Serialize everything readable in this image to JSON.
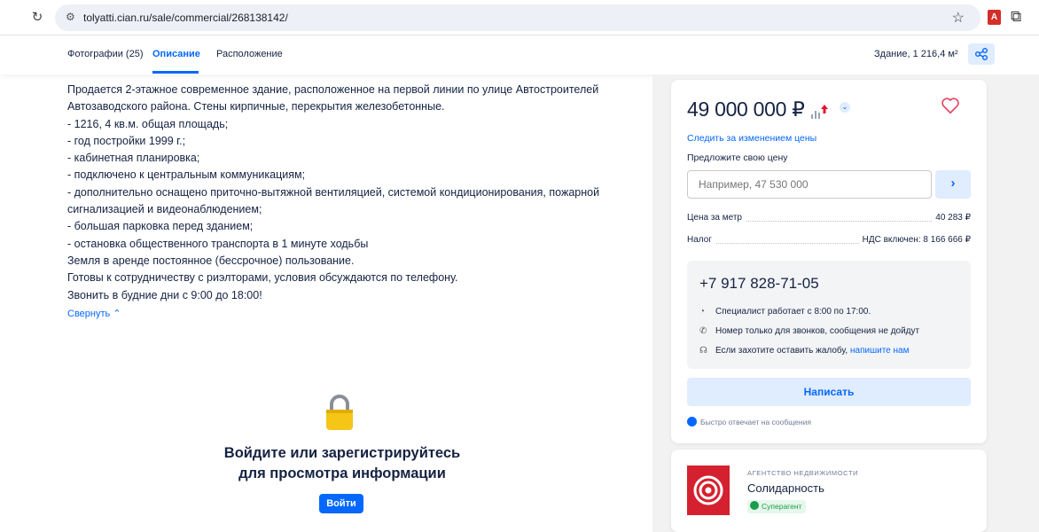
{
  "browser": {
    "url": "tolyatti.cian.ru/sale/commercial/268138142/",
    "pdf_ext_label": "A"
  },
  "tabs": [
    {
      "label": "Фотографии (25)"
    },
    {
      "label": "Описание"
    },
    {
      "label": "Расположение"
    }
  ],
  "header": {
    "building_info": "Здание, 1 216,4 м²"
  },
  "description": {
    "lines": [
      "Продается 2-этажное современное здание, расположенное на первой линии по улице Автостроителей",
      "Автозаводского района. Стены кирпичные, перекрытия железобетонные.",
      "- 1216, 4 кв.м. общая площадь;",
      "- год постройки 1999 г.;",
      "- кабинетная планировка;",
      "- подключено к центральным коммуникациям;",
      "- дополнительно оснащено приточно-вытяжной вентиляцией, системой кондиционирования, пожарной",
      "сигнализацией и видеонаблюдением;",
      "- большая парковка перед зданием;",
      "- остановка общественного транспорта в 1 минуте ходьбы",
      "Земля в аренде  постоянное (бессрочное) пользование.",
      "Готовы к сотрудничеству с риэлторами, условия обсуждаются по телефону.",
      "Звонить в будние дни с 9:00 до 18:00!"
    ],
    "collapse_label": "Свернуть ⌃"
  },
  "login": {
    "title_line1": "Войдите или зарегистрируйтесь",
    "title_line2": "для просмотра информации",
    "button_label": "Войти"
  },
  "price_card": {
    "price": "49 000 000 ₽",
    "follow_label": "Следить за изменением цены",
    "offer_label": "Предложите свою цену",
    "offer_placeholder": "Например, 47 530 000",
    "rows": [
      {
        "label": "Цена за метр",
        "value": "40 283 ₽"
      },
      {
        "label": "Налог",
        "value": "НДС включен: 8 166 666 ₽"
      }
    ],
    "phone": "+7 917 828-71-05",
    "info": {
      "hours": "Специалист работает с 8:00 по 17:00.",
      "calls_only": "Номер только для звонков, сообщения не дойдут",
      "complaint_text": "Если захотите оставить жалобу,",
      "complaint_link": "напишите нам"
    },
    "write_label": "Написать",
    "fast_reply": "Быстро отвечает на сообщения"
  },
  "agency": {
    "type": "АГЕНТСТВО НЕДВИЖИМОСТИ",
    "name": "Солидарность",
    "badge": "Суперагент"
  },
  "colors": {
    "accent": "#0468ff",
    "accent_light": "#e0ecff",
    "text": "#152242",
    "heart": "#e84260",
    "price_up": "#e8112d",
    "agency_logo": "#d5212f",
    "badge_green": "#1a9e4b"
  }
}
